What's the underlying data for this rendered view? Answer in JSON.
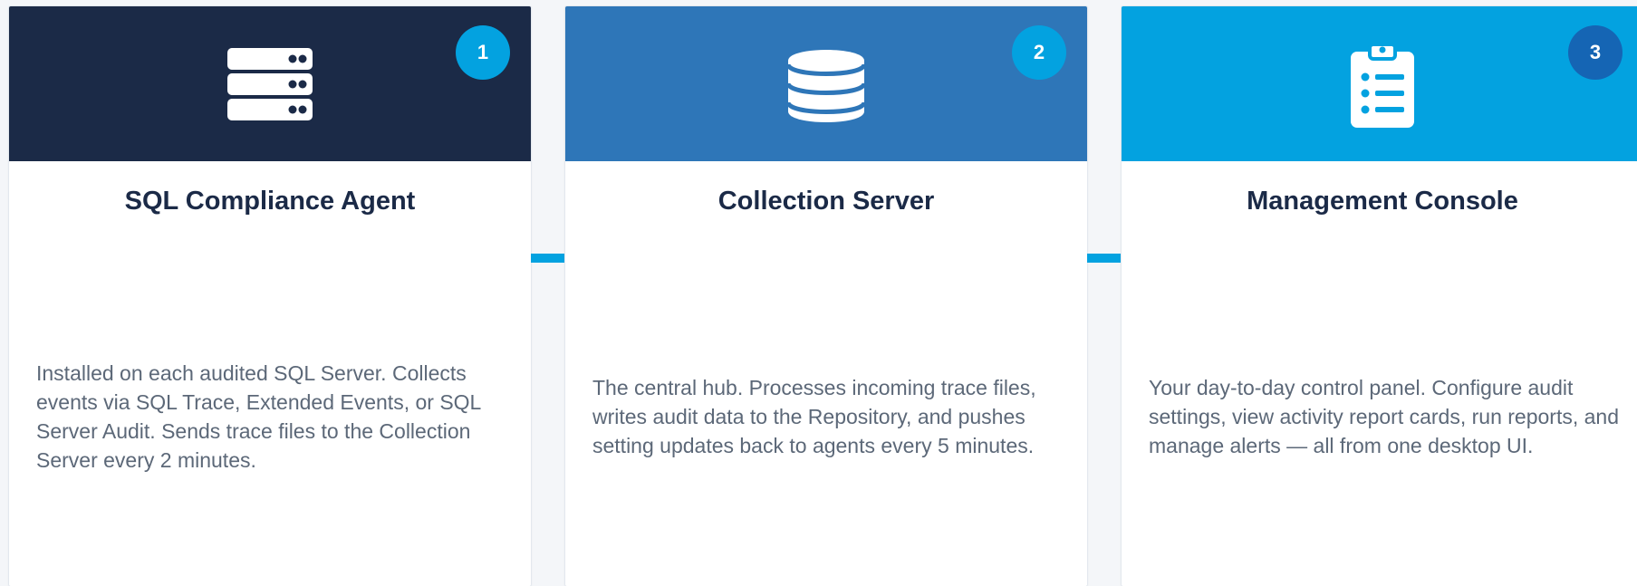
{
  "cards": [
    {
      "number": "1",
      "icon": "server-icon",
      "title": "SQL Compliance Agent",
      "description": "Installed on each audited SQL Server. Collects events via SQL Trace, Extended Events, or SQL Server Audit. Sends trace files to the Collection Server every 2 minutes."
    },
    {
      "number": "2",
      "icon": "database-icon",
      "title": "Collection Server",
      "description": "The central hub. Processes incoming trace files, writes audit data to the Repository, and pushes setting updates back to agents every 5 minutes."
    },
    {
      "number": "3",
      "icon": "clipboard-list-icon",
      "title": "Management Console",
      "description": "Your day-to-day control panel. Configure audit settings, view activity report cards, run reports, and manage alerts — all from one desktop UI."
    }
  ],
  "colors": {
    "navy": "#1b2a47",
    "mid_blue": "#2e76b8",
    "sky_blue": "#03a2e0",
    "badge_dark": "#1565b4",
    "connector": "#03a2e0"
  }
}
